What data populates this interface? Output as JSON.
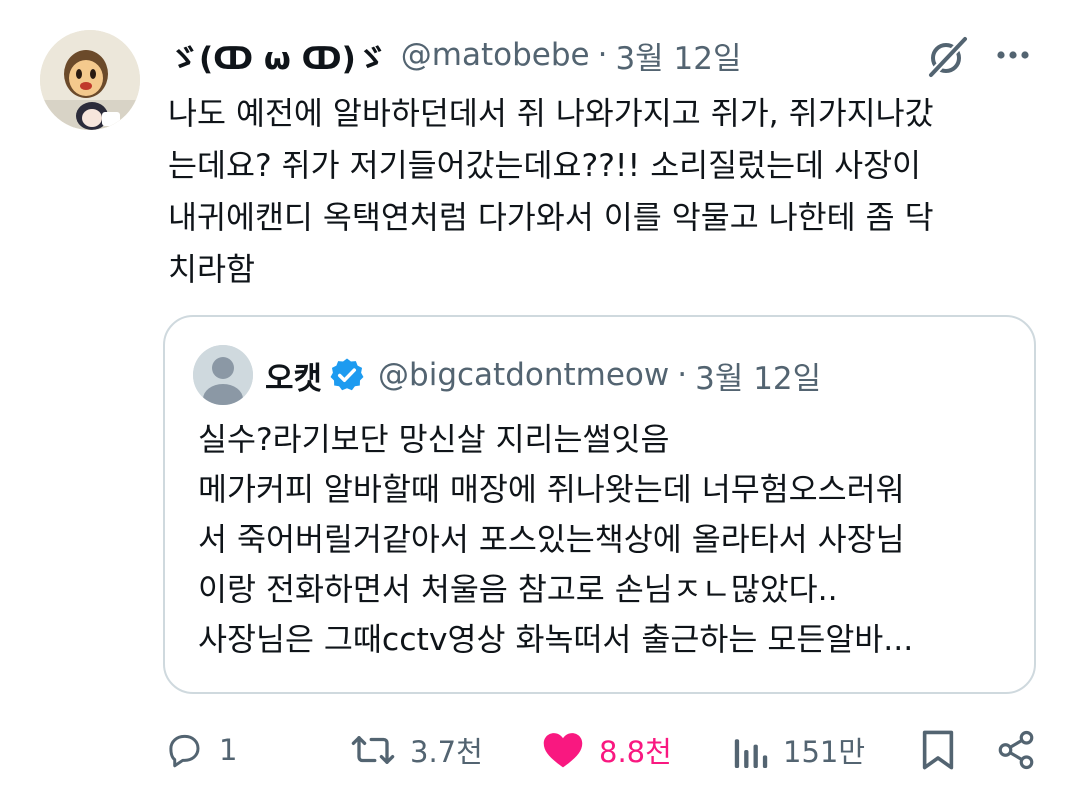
{
  "tweet": {
    "display_name": "ゞ(ↀ ω ↀ)ゞ",
    "handle": "@matobebe",
    "separator": "·",
    "date": "3월 12일",
    "body_lines": [
      "나도 예전에 알바하던데서 쥐 나와가지고 쥐가, 쥐가지나갔",
      "는데요? 쥐가 저기들어갔는데요??!! 소리질렀는데 사장이",
      "내귀에캔디 옥택연처럼 다가와서 이를 악물고 나한테 좀 닥",
      "치라함"
    ]
  },
  "quote": {
    "display_name": "오캣",
    "handle": "@bigcatdontmeow",
    "separator": "·",
    "date": "3월 12일",
    "body_lines": [
      "실수?라기보단 망신살 지리는썰잇음",
      "메가커피 알바할때 매장에 쥐나왓는데 너무험오스러워",
      "서 죽어버릴거같아서 포스있는책상에 올라타서 사장님",
      "이랑 전화하면서 처울음 참고로 손님ㅈㄴ많았다..",
      "사장님은 그때cctv영상 화녹떠서 출근하는 모든알바..."
    ]
  },
  "actions": {
    "replies": "1",
    "reposts": "3.7천",
    "likes": "8.8천",
    "views": "151만"
  },
  "icons": {
    "grok": "grok-icon",
    "more": "more-icon",
    "verified": "verified-badge-icon",
    "reply": "reply-icon",
    "repost": "repost-icon",
    "like": "heart-icon",
    "views": "views-icon",
    "bookmark": "bookmark-icon",
    "share": "share-icon"
  },
  "colors": {
    "text": "#0f1419",
    "secondary": "#536471",
    "like": "#f91880",
    "verified": "#1d9bf0",
    "border": "#cfd9de"
  }
}
